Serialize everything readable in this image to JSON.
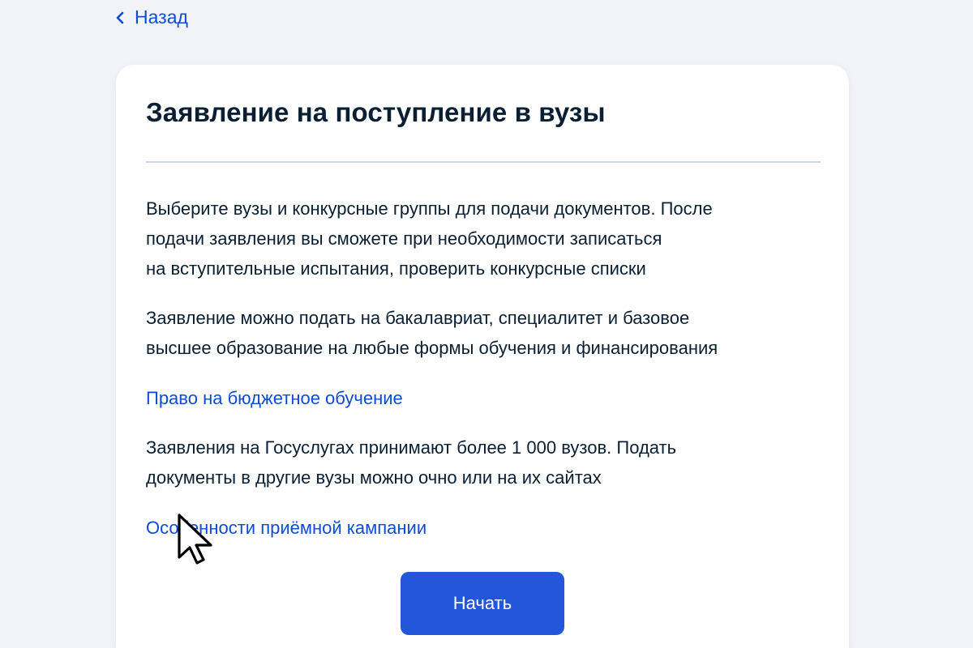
{
  "nav": {
    "back_label": "Назад",
    "back_icon": "chevron-left-icon"
  },
  "card": {
    "title": "Заявление на поступление в вузы",
    "paragraph1_lines": [
      "Выберите вузы и конкурсные группы для подачи документов. После",
      "подачи заявления вы сможете при необходимости записаться",
      "на вступительные испытания, проверить конкурсные списки"
    ],
    "paragraph2_lines": [
      "Заявление можно подать на бакалавриат, специалитет и базовое",
      "высшее образование на любые формы обучения и финансирования"
    ],
    "link1_label": "Право на бюджетное обучение",
    "paragraph3_lines": [
      "Заявления на Госуслугах принимают более 1 000 вузов. Подать",
      "документы в другие вузы можно очно или на их сайтах"
    ],
    "link2_label": "Особенности приёмной кампании",
    "start_button_label": "Начать"
  },
  "colors": {
    "background": "#f1f3f8",
    "card": "#ffffff",
    "text": "#0b1f33",
    "link": "#0d4cd3",
    "button": "#2356d8",
    "divider": "#cdd7e6"
  },
  "pointer_icon": "mouse-pointer-icon"
}
